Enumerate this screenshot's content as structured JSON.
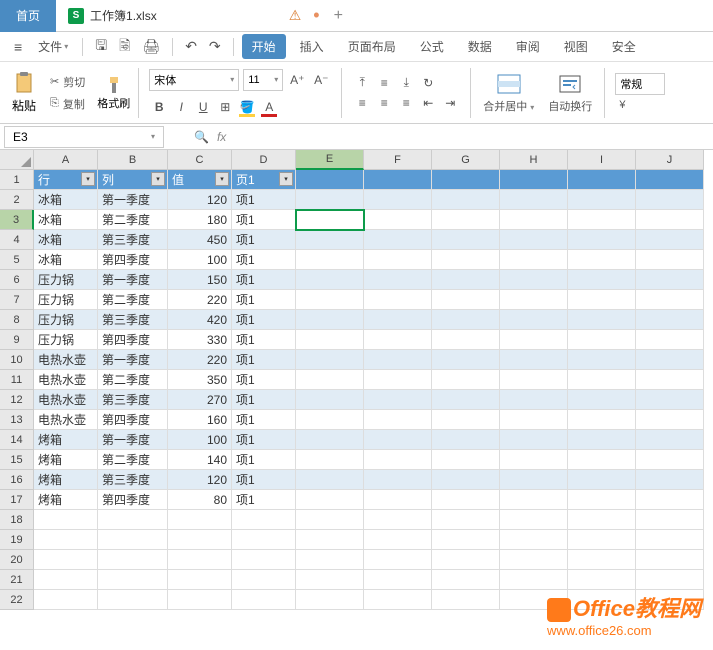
{
  "title_bar": {
    "home": "首页",
    "file_tab": "工作簿1.xlsx",
    "file_badge": "S"
  },
  "menu": {
    "file": "文件",
    "tabs": [
      "开始",
      "插入",
      "页面布局",
      "公式",
      "数据",
      "审阅",
      "视图",
      "安全"
    ],
    "active_tab": "开始"
  },
  "ribbon": {
    "paste": "粘贴",
    "cut": "剪切",
    "copy": "复制",
    "brush": "格式刷",
    "font_name": "宋体",
    "font_size": "11",
    "merge": "合并居中",
    "wrap": "自动换行",
    "general": "常规"
  },
  "formula": {
    "cell_ref": "E3"
  },
  "cols": [
    "A",
    "B",
    "C",
    "D",
    "E",
    "F",
    "G",
    "H",
    "I",
    "J"
  ],
  "headers": [
    "行",
    "列",
    "值",
    "页1"
  ],
  "rows": [
    {
      "a": "冰箱",
      "b": "第一季度",
      "c": "120",
      "d": "项1"
    },
    {
      "a": "冰箱",
      "b": "第二季度",
      "c": "180",
      "d": "项1"
    },
    {
      "a": "冰箱",
      "b": "第三季度",
      "c": "450",
      "d": "项1"
    },
    {
      "a": "冰箱",
      "b": "第四季度",
      "c": "100",
      "d": "项1"
    },
    {
      "a": "压力锅",
      "b": "第一季度",
      "c": "150",
      "d": "项1"
    },
    {
      "a": "压力锅",
      "b": "第二季度",
      "c": "220",
      "d": "项1"
    },
    {
      "a": "压力锅",
      "b": "第三季度",
      "c": "420",
      "d": "项1"
    },
    {
      "a": "压力锅",
      "b": "第四季度",
      "c": "330",
      "d": "项1"
    },
    {
      "a": "电热水壶",
      "b": "第一季度",
      "c": "220",
      "d": "项1"
    },
    {
      "a": "电热水壶",
      "b": "第二季度",
      "c": "350",
      "d": "项1"
    },
    {
      "a": "电热水壶",
      "b": "第三季度",
      "c": "270",
      "d": "项1"
    },
    {
      "a": "电热水壶",
      "b": "第四季度",
      "c": "160",
      "d": "项1"
    },
    {
      "a": "烤箱",
      "b": "第一季度",
      "c": "100",
      "d": "项1"
    },
    {
      "a": "烤箱",
      "b": "第二季度",
      "c": "140",
      "d": "项1"
    },
    {
      "a": "烤箱",
      "b": "第三季度",
      "c": "120",
      "d": "项1"
    },
    {
      "a": "烤箱",
      "b": "第四季度",
      "c": "80",
      "d": "项1"
    }
  ],
  "watermark": {
    "title": "Office教程网",
    "url": "www.office26.com"
  }
}
